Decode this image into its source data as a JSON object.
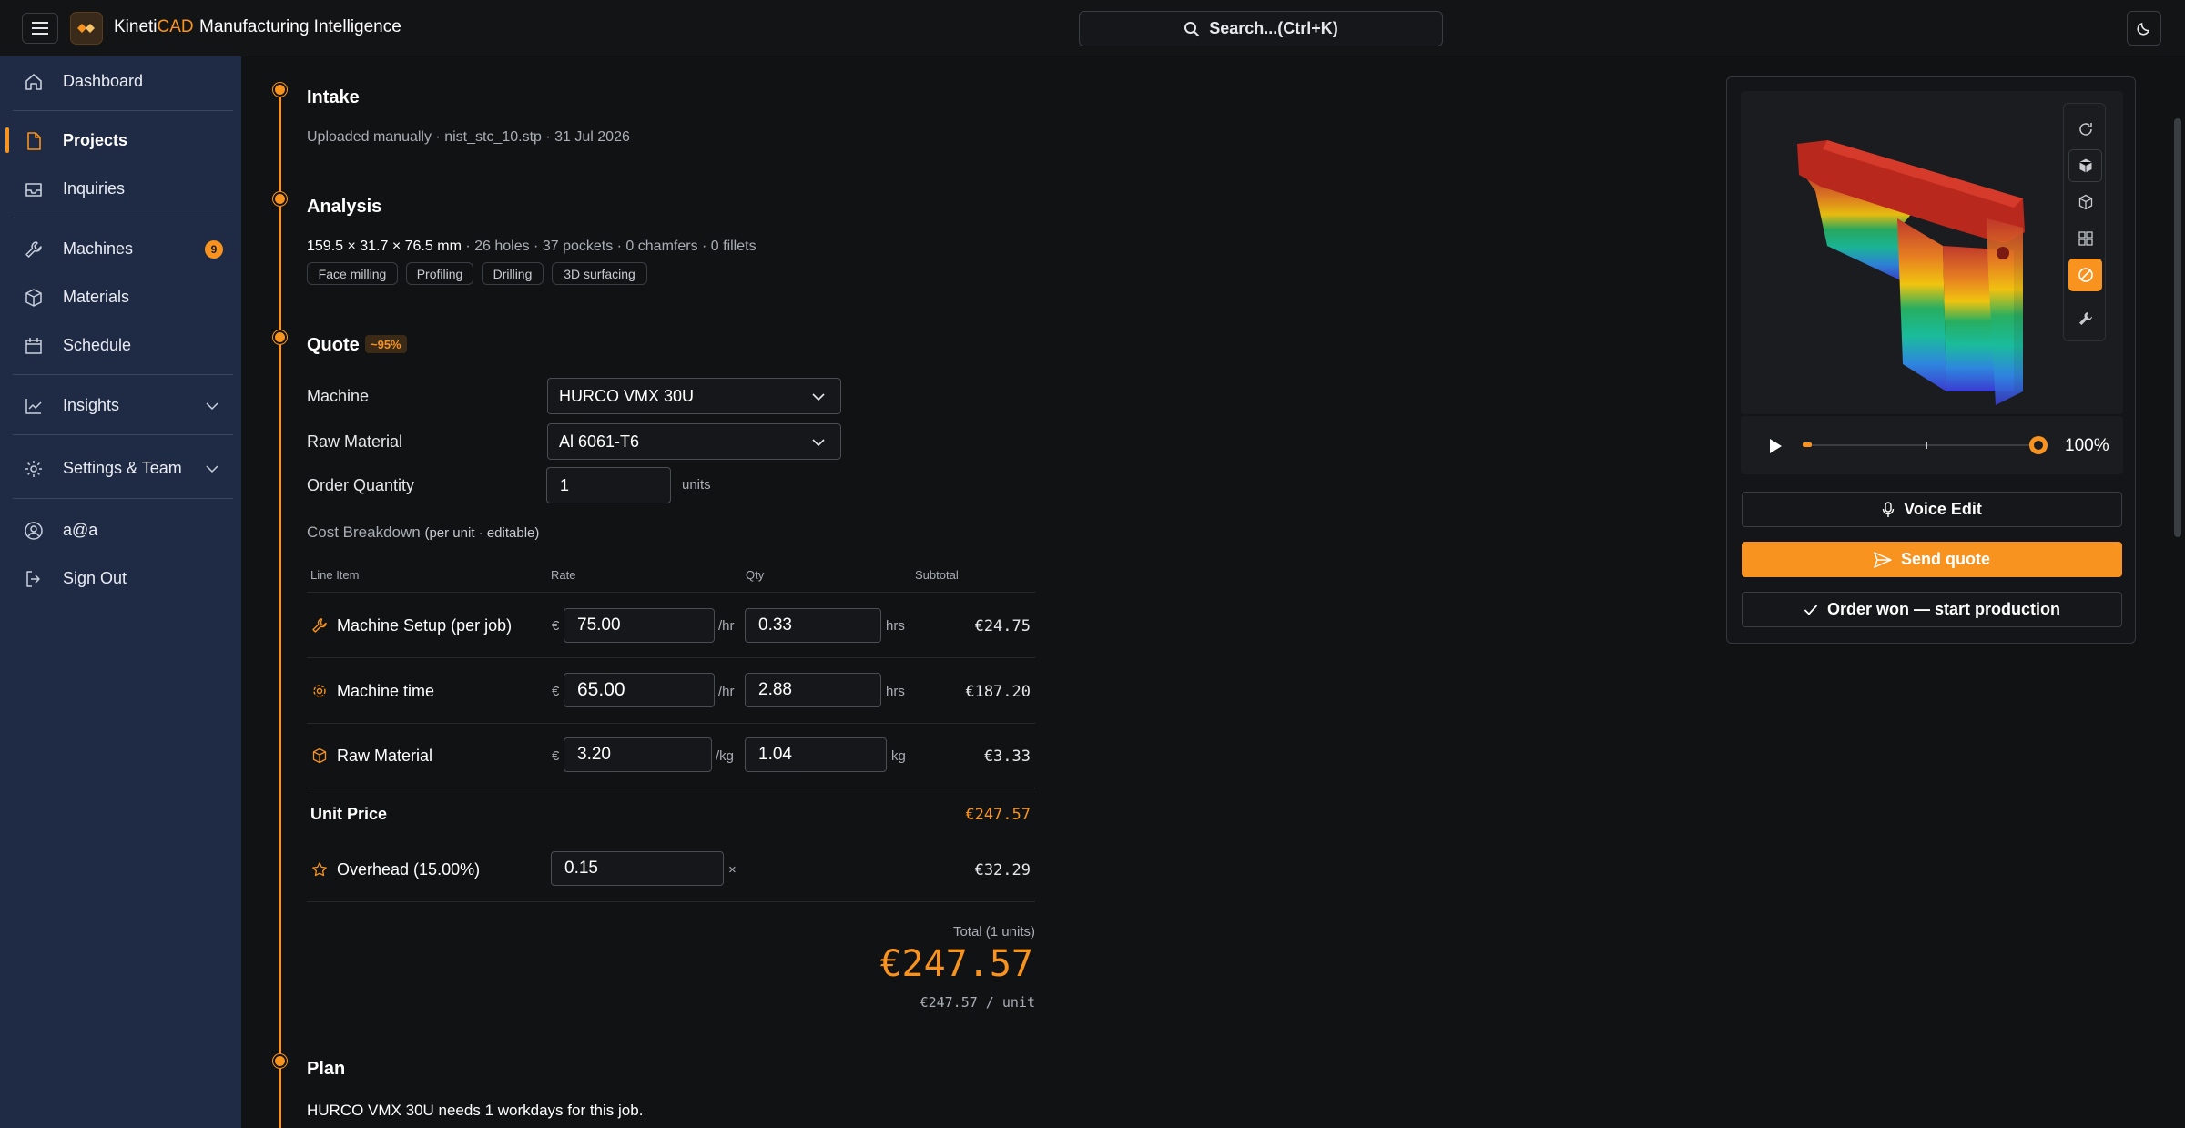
{
  "app": {
    "brand_prefix": "Kineti",
    "brand_suffix": "CAD",
    "subtitle": "Manufacturing Intelligence",
    "search_label": "Search...(Ctrl+K)"
  },
  "colors": {
    "accent": "#f7931e",
    "sidebar_bg": "#1f2a44",
    "page_bg": "#111214"
  },
  "sidebar": {
    "items": [
      {
        "label": "Dashboard",
        "icon": "home-icon"
      },
      {
        "label": "Projects",
        "icon": "file-icon",
        "active": true
      },
      {
        "label": "Inquiries",
        "icon": "inbox-icon"
      },
      {
        "label": "Machines",
        "icon": "wrench-icon",
        "badge": "9"
      },
      {
        "label": "Materials",
        "icon": "box-icon"
      },
      {
        "label": "Schedule",
        "icon": "calendar-icon"
      },
      {
        "label": "Insights",
        "icon": "chart-icon"
      },
      {
        "label": "Settings & Team",
        "icon": "gear-icon"
      },
      {
        "label": "a@a",
        "icon": "user-icon"
      },
      {
        "label": "Sign Out",
        "icon": "sign-out-icon"
      }
    ]
  },
  "intake": {
    "title": "Intake",
    "desc": "Uploaded manually · nist_stc_10.stp · 31 Jul 2026"
  },
  "analysis": {
    "title": "Analysis",
    "dims": "159.5 × 31.7 × 76.5 mm",
    "features": " · 26 holes · 37 pockets · 0 chamfers · 0 fillets",
    "chips": [
      "Face milling",
      "Profiling",
      "Drilling",
      "3D surfacing"
    ]
  },
  "quote": {
    "title": "Quote",
    "confidence": "~95%",
    "machine_label": "Machine",
    "machine_value": "HURCO VMX 30U",
    "material_label": "Raw Material",
    "material_value": "Al 6061-T6",
    "qty_label": "Order Quantity",
    "qty_value": "1",
    "qty_unit": "units",
    "cost_title": "Cost Breakdown",
    "cost_hint": "(per unit · editable)",
    "headers": {
      "item": "Line Item",
      "rate": "Rate",
      "qty": "Qty",
      "subtotal": "Subtotal"
    },
    "rows": [
      {
        "label": "Machine Setup (per job)",
        "currency": "€",
        "rate": "75.00",
        "rate_unit": "/hr",
        "qty": "0.33",
        "qty_unit": "hrs",
        "subtotal": "€24.75"
      },
      {
        "label": "Machine time",
        "currency": "€",
        "rate": "65.00",
        "rate_unit": "/hr",
        "qty": "2.88",
        "qty_unit": "hrs",
        "subtotal": "€187.20"
      },
      {
        "label": "Raw Material",
        "currency": "€",
        "rate": "3.20",
        "rate_unit": "/kg",
        "qty": "1.04",
        "qty_unit": "kg",
        "subtotal": "€3.33"
      }
    ],
    "unit_price_label": "Unit Price",
    "unit_price": "€247.57",
    "overhead_label": "Overhead (15.00%)",
    "overhead_value": "0.15",
    "overhead_unit": "×",
    "overhead_subtotal": "€32.29",
    "total_label": "Total (1 units)",
    "total": "€247.57",
    "per_unit": "€247.57 / unit"
  },
  "plan": {
    "title": "Plan",
    "desc": "HURCO VMX 30U needs 1 workdays for this job."
  },
  "viewer": {
    "zoom": "100%",
    "progress": 0.02,
    "voice_edit": "Voice Edit",
    "send_quote": "Send quote",
    "order_won": "Order won — start production"
  }
}
